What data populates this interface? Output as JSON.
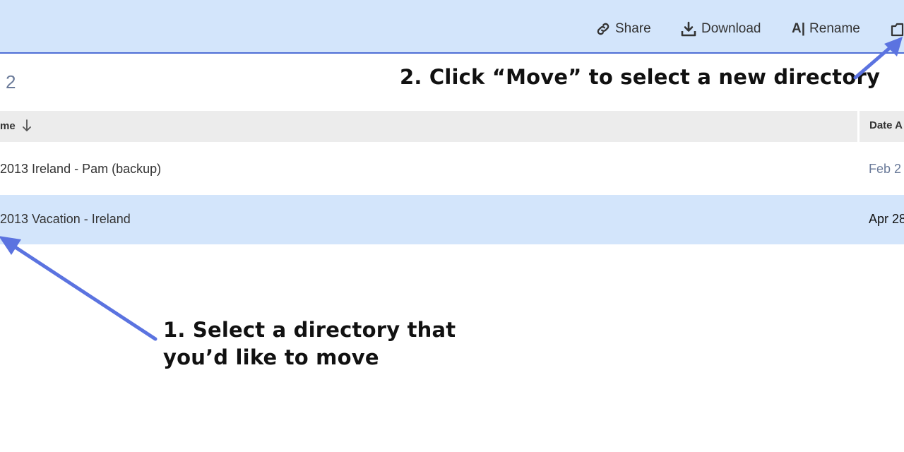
{
  "toolbar": {
    "share_label": "Share",
    "download_label": "Download",
    "rename_icon_text": "A|",
    "rename_label": "Rename",
    "move_icon": "move-icon"
  },
  "folder": {
    "count_text": "2"
  },
  "table": {
    "columns": {
      "name_header": "me",
      "date_header": "Date A"
    },
    "rows": [
      {
        "name": "2013 Ireland - Pam (backup)",
        "date": "Feb 2",
        "selected": false
      },
      {
        "name": "2013 Vacation - Ireland",
        "date": "Apr 28",
        "selected": true
      }
    ]
  },
  "annotations": {
    "step2": "2. Click “Move” to select a new directory",
    "step1_line1": "1. Select a directory that",
    "step1_line2": "you’d like to move"
  },
  "colors": {
    "toolbar_bg": "#d3e5fb",
    "toolbar_border": "#4f6fd6",
    "selected_row_bg": "#d3e5fb",
    "header_bg": "#ececec",
    "arrow": "#5b73e0"
  }
}
